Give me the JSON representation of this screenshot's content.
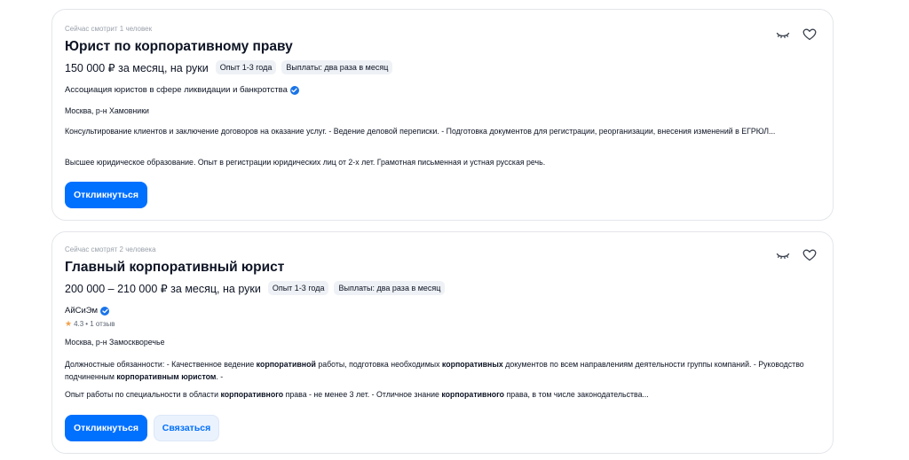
{
  "vacancies": [
    {
      "viewers": "Сейчас смотрит 1 человек",
      "title": "Юрист по корпоративному праву",
      "salary": "150 000 ₽ за месяц, на руки",
      "experience": "Опыт 1-3 года",
      "payouts": "Выплаты: два раза в месяц",
      "company": "Ассоциация юристов в сфере ликвидации и банкротства",
      "location": "Москва, р-н Хамовники",
      "responsibilities": "Консультирование клиентов и заключение договоров на оказание услуг. - Ведение деловой переписки. - Подготовка документов для регистрации, реорганизации, внесения изменений в ЕГРЮЛ...",
      "requirements": "Высшее юридическое образование. Опыт в регистрации юридических лиц от 2-х лет. Грамотная письменная и устная русская речь.",
      "apply_label": "Откликнуться"
    },
    {
      "viewers": "Сейчас смотрят 2 человека",
      "title": "Главный корпоративный юрист",
      "salary": "200 000 – 210 000 ₽ за месяц, на руки",
      "experience": "Опыт 1-3 года",
      "payouts": "Выплаты: два раза в месяц",
      "company": "АйСиЭм",
      "rating": "4.3",
      "reviews": "• 1 отзыв",
      "location": "Москва, р-н Замоскворечье",
      "responsibilities_parts": [
        "Должностные обязанности: - Качественное ведение ",
        "корпоративной",
        " работы, подготовка необходимых ",
        "корпоративных",
        " документов по всем направлениям деятельности группы компаний. - Руководство подчиненным ",
        "корпоративным юристом",
        ". -"
      ],
      "requirements_parts": [
        "Опыт работы по специальности в области ",
        "корпоративного",
        " права - не менее 3 лет. - Отличное знание ",
        "корпоративного",
        " права, в том числе законодательства..."
      ],
      "apply_label": "Откликнуться",
      "contact_label": "Связаться"
    }
  ],
  "icons": {
    "hide": "eye-closed-icon",
    "favorite": "heart-icon",
    "verified": "verified-check-icon",
    "star": "star-icon"
  },
  "colors": {
    "primary": "#0070ff",
    "tag_bg": "#eef1f5",
    "muted": "#9aa1ab",
    "star": "#f0a24c"
  }
}
